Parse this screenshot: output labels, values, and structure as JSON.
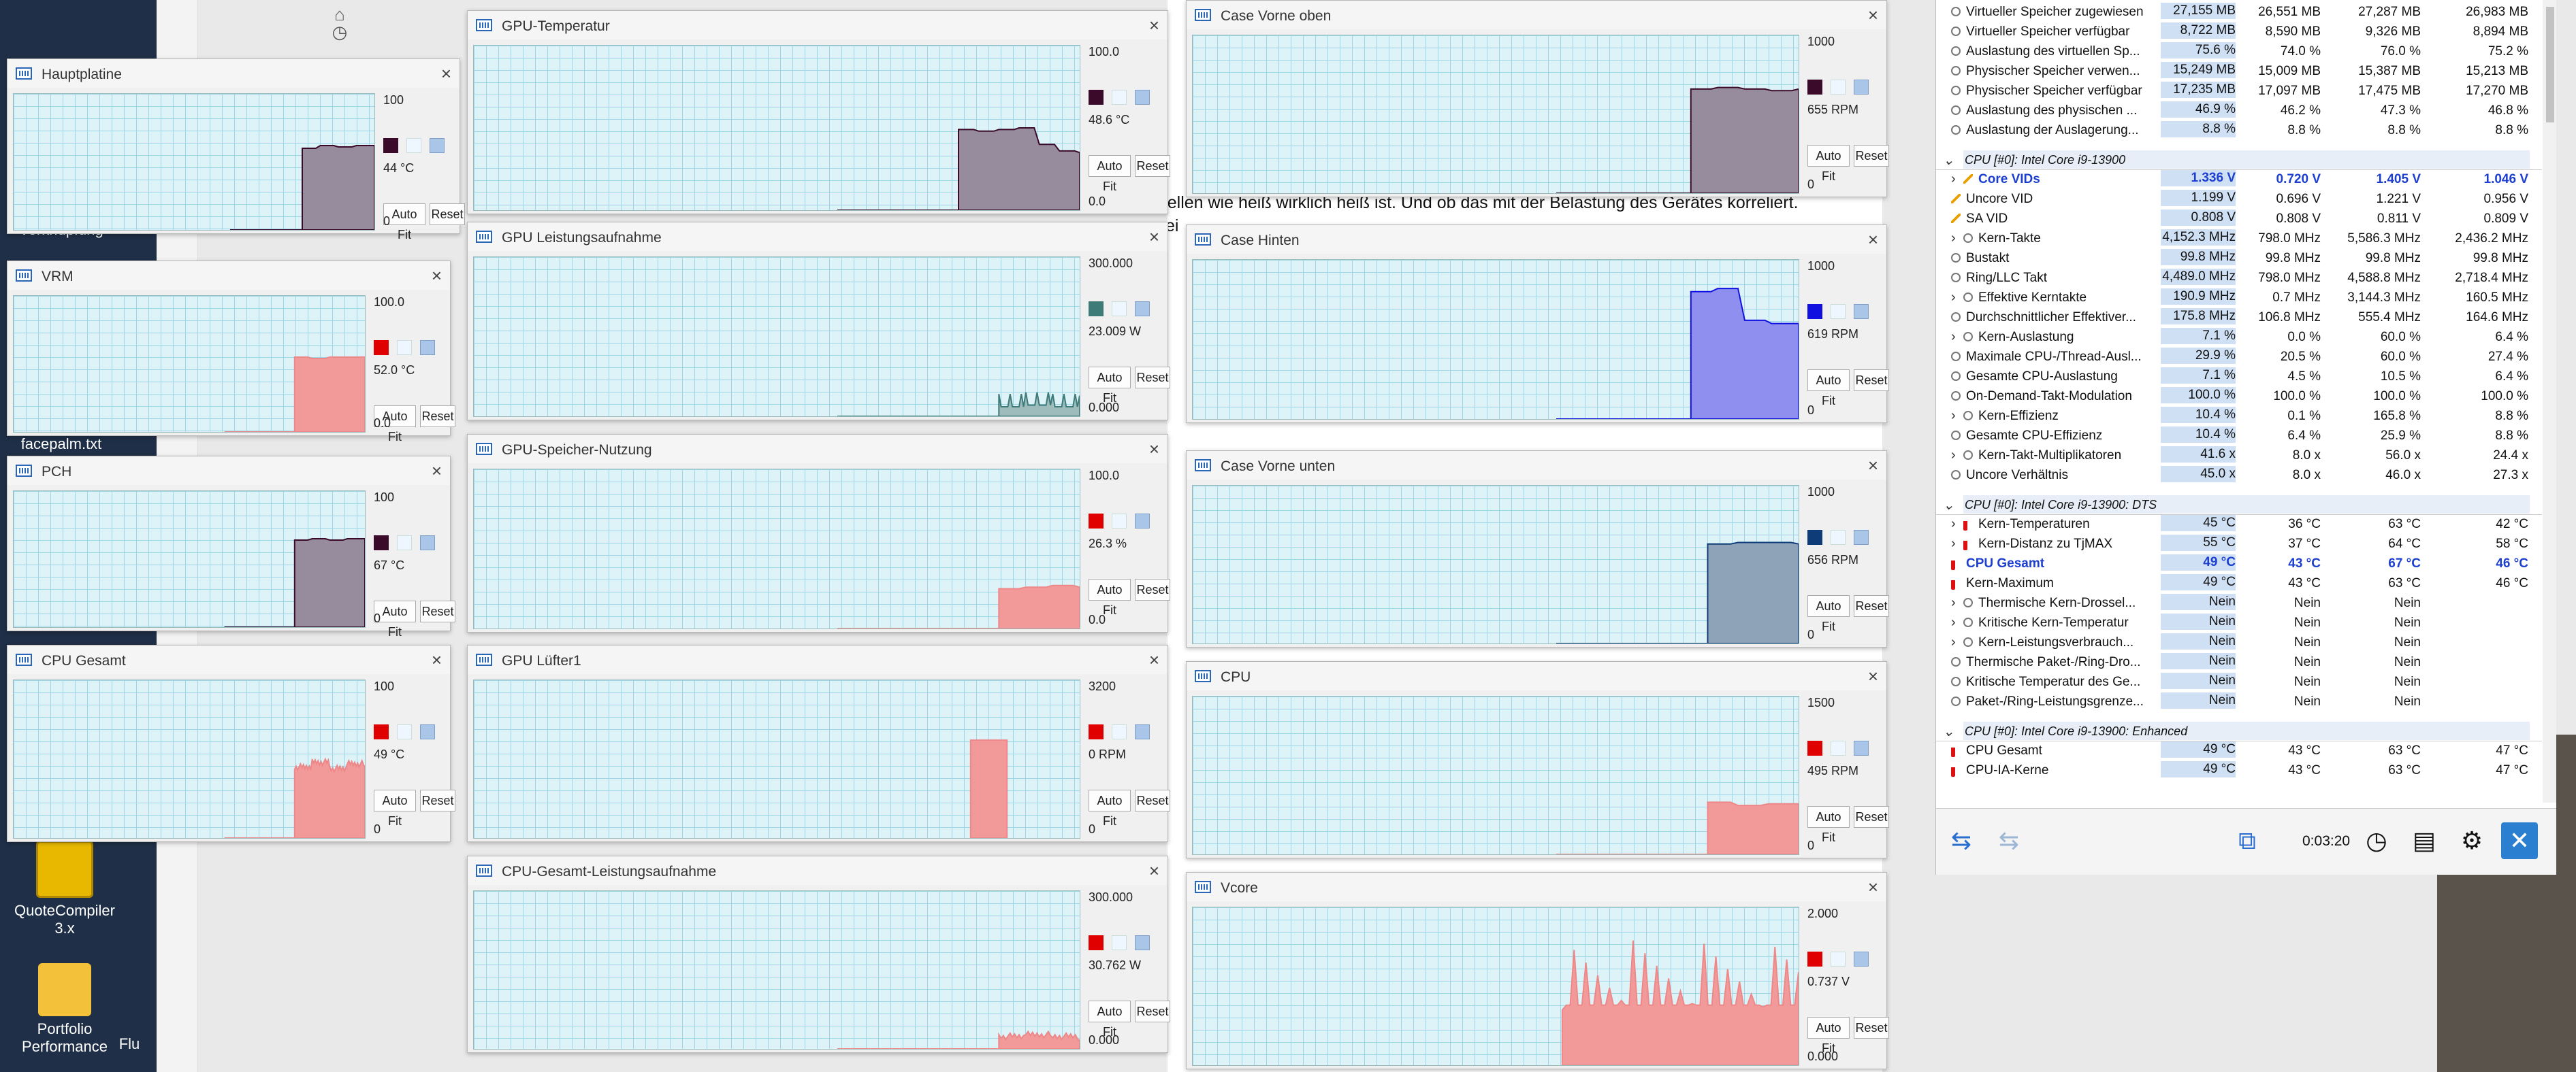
{
  "desktop": {
    "icons": [
      {
        "label": "Verknüpfung"
      },
      {
        "label": "facepalm.txt"
      },
      {
        "label": "QuoteCompiler 3.x"
      },
      {
        "label": "Portfolio Performance"
      },
      {
        "label": "Flu"
      }
    ]
  },
  "document": {
    "line1": "feststellen wie heiß wirklich heiß ist. Und ob das mit der Belastung des Gerätes korreliert.",
    "line2_fragment": "ei"
  },
  "graphs": [
    {
      "title": "Hauptplatine",
      "max": "100",
      "current": "44 °C",
      "min": "0",
      "color": "#3b0a2a",
      "fill": "#978c9e"
    },
    {
      "title": "VRM",
      "max": "100.0",
      "current": "52.0 °C",
      "min": "0.0",
      "color": "#e00000",
      "fill": "#f2999a"
    },
    {
      "title": "PCH",
      "max": "100",
      "current": "67 °C",
      "min": "0",
      "color": "#3b0a2a",
      "fill": "#978c9e"
    },
    {
      "title": "CPU Gesamt",
      "max": "100",
      "current": "49 °C",
      "min": "0",
      "color": "#e00000",
      "fill": "#f2999a"
    },
    {
      "title": "GPU-Temperatur",
      "max": "100.0",
      "current": "48.6 °C",
      "min": "0.0",
      "color": "#3b0a2a",
      "fill": "#978c9e"
    },
    {
      "title": "GPU Leistungsaufnahme",
      "max": "300.000",
      "current": "23.009 W",
      "min": "0.000",
      "color": "#3d7a78",
      "fill": "#9fbcbc"
    },
    {
      "title": "GPU-Speicher-Nutzung",
      "max": "100.0",
      "current": "26.3 %",
      "min": "0.0",
      "color": "#e00000",
      "fill": "#f2999a"
    },
    {
      "title": "GPU Lüfter1",
      "max": "3200",
      "current": "0 RPM",
      "min": "0",
      "color": "#e00000",
      "fill": "#f2999a"
    },
    {
      "title": "CPU-Gesamt-Leistungsaufnahme",
      "max": "300.000",
      "current": "30.762 W",
      "min": "0.000",
      "color": "#e00000",
      "fill": "#f2999a"
    },
    {
      "title": "Case Vorne oben",
      "max": "1000",
      "current": "655 RPM",
      "min": "0",
      "color": "#3b0a2a",
      "fill": "#978c9e"
    },
    {
      "title": "Case Hinten",
      "max": "1000",
      "current": "619 RPM",
      "min": "0",
      "color": "#1010e0",
      "fill": "#8f8ff0"
    },
    {
      "title": "Case Vorne unten",
      "max": "1000",
      "current": "656 RPM",
      "min": "0",
      "color": "#0e3c78",
      "fill": "#8fa3b8"
    },
    {
      "title": "CPU",
      "max": "1500",
      "current": "495 RPM",
      "min": "0",
      "color": "#e00000",
      "fill": "#f2999a"
    },
    {
      "title": "Vcore",
      "max": "2.000",
      "current": "0.737 V",
      "min": "0.000",
      "color": "#e00000",
      "fill": "#f2999a"
    }
  ],
  "buttons": {
    "autofit": "Auto Fit",
    "reset": "Reset"
  },
  "hwinfo": {
    "rows": [
      {
        "type": "row",
        "icon": "circle",
        "label": "Virtueller Speicher zugewiesen",
        "v": [
          "27,155 MB",
          "26,551 MB",
          "27,287 MB",
          "26,983 MB"
        ]
      },
      {
        "type": "row",
        "icon": "circle",
        "label": "Virtueller Speicher verfügbar",
        "v": [
          "8,722 MB",
          "8,590 MB",
          "9,326 MB",
          "8,894 MB"
        ]
      },
      {
        "type": "row",
        "icon": "circle",
        "label": "Auslastung des virtuellen Sp...",
        "v": [
          "75.6 %",
          "74.0 %",
          "76.0 %",
          "75.2 %"
        ]
      },
      {
        "type": "row",
        "icon": "circle",
        "label": "Physischer Speicher verwen...",
        "v": [
          "15,249 MB",
          "15,009 MB",
          "15,387 MB",
          "15,213 MB"
        ]
      },
      {
        "type": "row",
        "icon": "circle",
        "label": "Physischer Speicher verfügbar",
        "v": [
          "17,235 MB",
          "17,097 MB",
          "17,475 MB",
          "17,270 MB"
        ]
      },
      {
        "type": "row",
        "icon": "circle",
        "label": "Auslastung des physischen ...",
        "v": [
          "46.9 %",
          "46.2 %",
          "47.3 %",
          "46.8 %"
        ]
      },
      {
        "type": "row",
        "icon": "circle",
        "label": "Auslastung der Auslagerung...",
        "v": [
          "8.8 %",
          "8.8 %",
          "8.8 %",
          "8.8 %"
        ]
      },
      {
        "type": "gap"
      },
      {
        "type": "sect",
        "label": "CPU [#0]: Intel Core i9-13900"
      },
      {
        "type": "row",
        "icon": "volt",
        "exp": true,
        "blue": true,
        "label": "Core VIDs",
        "v": [
          "1.336 V",
          "0.720 V",
          "1.405 V",
          "1.046 V"
        ]
      },
      {
        "type": "row",
        "icon": "volt",
        "label": "Uncore VID",
        "v": [
          "1.199 V",
          "0.696 V",
          "1.221 V",
          "0.956 V"
        ]
      },
      {
        "type": "row",
        "icon": "volt",
        "label": "SA VID",
        "v": [
          "0.808 V",
          "0.808 V",
          "0.811 V",
          "0.809 V"
        ]
      },
      {
        "type": "row",
        "icon": "circle",
        "exp": true,
        "label": "Kern-Takte",
        "v": [
          "4,152.3 MHz",
          "798.0 MHz",
          "5,586.3 MHz",
          "2,436.2 MHz"
        ]
      },
      {
        "type": "row",
        "icon": "circle",
        "label": "Bustakt",
        "v": [
          "99.8 MHz",
          "99.8 MHz",
          "99.8 MHz",
          "99.8 MHz"
        ]
      },
      {
        "type": "row",
        "icon": "circle",
        "label": "Ring/LLC Takt",
        "v": [
          "4,489.0 MHz",
          "798.0 MHz",
          "4,588.8 MHz",
          "2,718.4 MHz"
        ]
      },
      {
        "type": "row",
        "icon": "circle",
        "exp": true,
        "label": "Effektive Kerntakte",
        "v": [
          "190.9 MHz",
          "0.7 MHz",
          "3,144.3 MHz",
          "160.5 MHz"
        ]
      },
      {
        "type": "row",
        "icon": "circle",
        "label": "Durchschnittlicher Effektiver...",
        "v": [
          "175.8 MHz",
          "106.8 MHz",
          "555.4 MHz",
          "164.6 MHz"
        ]
      },
      {
        "type": "row",
        "icon": "circle",
        "exp": true,
        "label": "Kern-Auslastung",
        "v": [
          "7.1 %",
          "0.0 %",
          "60.0 %",
          "6.4 %"
        ]
      },
      {
        "type": "row",
        "icon": "circle",
        "label": "Maximale CPU-/Thread-Ausl...",
        "v": [
          "29.9 %",
          "20.5 %",
          "60.0 %",
          "27.4 %"
        ]
      },
      {
        "type": "row",
        "icon": "circle",
        "label": "Gesamte CPU-Auslastung",
        "v": [
          "7.1 %",
          "4.5 %",
          "10.5 %",
          "6.4 %"
        ]
      },
      {
        "type": "row",
        "icon": "circle",
        "label": "On-Demand-Takt-Modulation",
        "v": [
          "100.0 %",
          "100.0 %",
          "100.0 %",
          "100.0 %"
        ]
      },
      {
        "type": "row",
        "icon": "circle",
        "exp": true,
        "label": "Kern-Effizienz",
        "v": [
          "10.4 %",
          "0.1 %",
          "165.8 %",
          "8.8 %"
        ]
      },
      {
        "type": "row",
        "icon": "circle",
        "label": "Gesamte CPU-Effizienz",
        "v": [
          "10.4 %",
          "6.4 %",
          "25.9 %",
          "8.8 %"
        ]
      },
      {
        "type": "row",
        "icon": "circle",
        "exp": true,
        "label": "Kern-Takt-Multiplikatoren",
        "v": [
          "41.6 x",
          "8.0 x",
          "56.0 x",
          "24.4 x"
        ]
      },
      {
        "type": "row",
        "icon": "circle",
        "label": "Uncore Verhältnis",
        "v": [
          "45.0 x",
          "8.0 x",
          "46.0 x",
          "27.3 x"
        ]
      },
      {
        "type": "gap"
      },
      {
        "type": "sect",
        "label": "CPU [#0]: Intel Core i9-13900: DTS"
      },
      {
        "type": "row",
        "icon": "temp",
        "exp": true,
        "label": "Kern-Temperaturen",
        "v": [
          "45 °C",
          "36 °C",
          "63 °C",
          "42 °C"
        ]
      },
      {
        "type": "row",
        "icon": "temp",
        "exp": true,
        "label": "Kern-Distanz zu TjMAX",
        "v": [
          "55 °C",
          "37 °C",
          "64 °C",
          "58 °C"
        ]
      },
      {
        "type": "row",
        "icon": "temp",
        "blue": true,
        "label": "CPU Gesamt",
        "v": [
          "49 °C",
          "43 °C",
          "67 °C",
          "46 °C"
        ]
      },
      {
        "type": "row",
        "icon": "temp",
        "label": "Kern-Maximum",
        "v": [
          "49 °C",
          "43 °C",
          "63 °C",
          "46 °C"
        ]
      },
      {
        "type": "row",
        "icon": "circle",
        "exp": true,
        "label": "Thermische Kern-Drossel...",
        "v": [
          "Nein",
          "Nein",
          "Nein",
          ""
        ]
      },
      {
        "type": "row",
        "icon": "circle",
        "exp": true,
        "label": "Kritische Kern-Temperatur",
        "v": [
          "Nein",
          "Nein",
          "Nein",
          ""
        ]
      },
      {
        "type": "row",
        "icon": "circle",
        "exp": true,
        "label": "Kern-Leistungsverbrauch...",
        "v": [
          "Nein",
          "Nein",
          "Nein",
          ""
        ]
      },
      {
        "type": "row",
        "icon": "circle",
        "label": "Thermische Paket-/Ring-Dro...",
        "v": [
          "Nein",
          "Nein",
          "Nein",
          ""
        ]
      },
      {
        "type": "row",
        "icon": "circle",
        "label": "Kritische Temperatur des Ge...",
        "v": [
          "Nein",
          "Nein",
          "Nein",
          ""
        ]
      },
      {
        "type": "row",
        "icon": "circle",
        "label": "Paket-/Ring-Leistungsgrenze...",
        "v": [
          "Nein",
          "Nein",
          "Nein",
          ""
        ]
      },
      {
        "type": "gap"
      },
      {
        "type": "sect",
        "label": "CPU [#0]: Intel Core i9-13900: Enhanced"
      },
      {
        "type": "row",
        "icon": "temp",
        "label": "CPU Gesamt",
        "v": [
          "49 °C",
          "43 °C",
          "63 °C",
          "47 °C"
        ]
      },
      {
        "type": "row",
        "icon": "temp",
        "label": "CPU-IA-Kerne",
        "v": [
          "49 °C",
          "43 °C",
          "63 °C",
          "47 °C"
        ]
      }
    ],
    "timer": "0:03:20"
  }
}
